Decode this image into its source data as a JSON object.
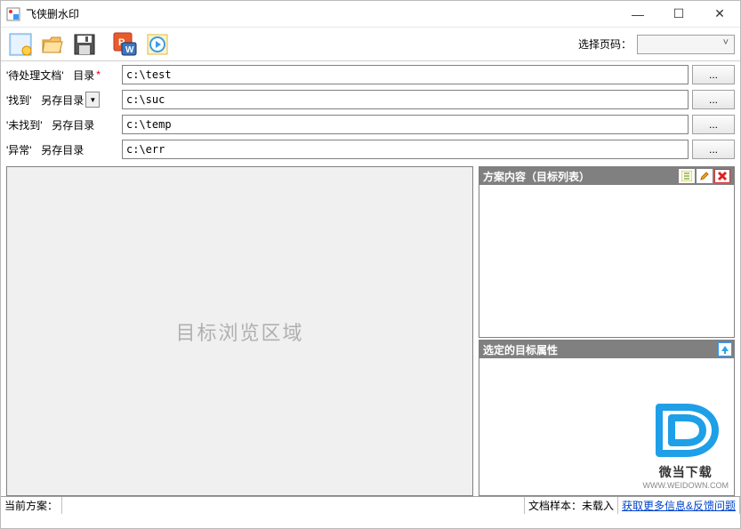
{
  "window": {
    "title": "飞侠删水印"
  },
  "toolbar": {
    "page_label": "选择页码："
  },
  "form": {
    "rows": [
      {
        "label_quoted": "'待处理文档'",
        "suffix": "目录",
        "required": true,
        "dropdown": false,
        "value": "c:\\test"
      },
      {
        "label_quoted": "'找到'",
        "suffix": "另存目录",
        "required": false,
        "dropdown": true,
        "value": "c:\\suc"
      },
      {
        "label_quoted": "'未找到'",
        "suffix": "另存目录",
        "required": false,
        "dropdown": false,
        "value": "c:\\temp"
      },
      {
        "label_quoted": "'异常'",
        "suffix": "另存目录",
        "required": false,
        "dropdown": false,
        "value": "c:\\err"
      }
    ],
    "browse_label": "..."
  },
  "preview": {
    "placeholder": "目标浏览区域"
  },
  "right": {
    "top_title": "方案内容（目标列表）",
    "bottom_title": "选定的目标属性"
  },
  "logo": {
    "title": "微当下载",
    "url": "WWW.WEIDOWN.COM"
  },
  "status": {
    "plan_label": "当前方案：",
    "plan_value": "",
    "sample_label": "文档样本：",
    "sample_value": "未载入",
    "link": "获取更多信息&反馈问题"
  }
}
